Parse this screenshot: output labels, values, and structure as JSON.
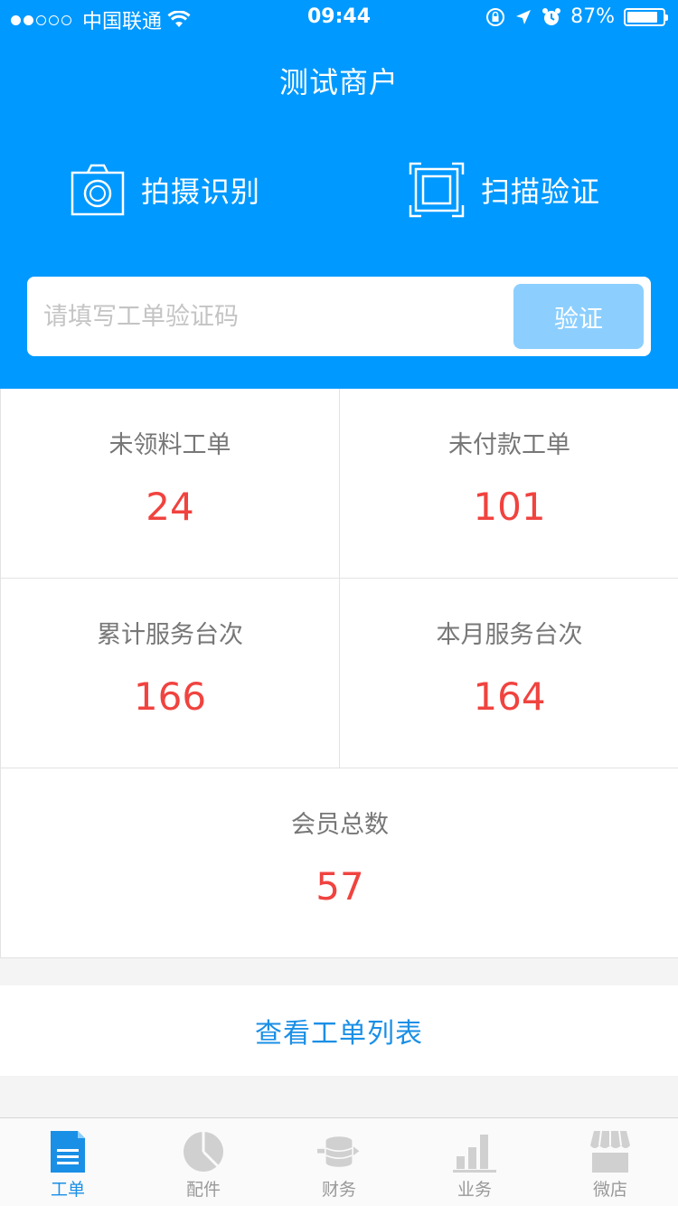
{
  "status_bar": {
    "carrier": "中国联通",
    "time": "09:44",
    "battery": "87%",
    "battery_level": 0.87,
    "signal_bars": 2
  },
  "header": {
    "title": "测试商户",
    "photo_action": {
      "label": "拍摄识别",
      "icon": "camera-icon"
    },
    "scan_action": {
      "label": "扫描验证",
      "icon": "scan-frame-icon"
    }
  },
  "verify": {
    "placeholder": "请填写工单验证码",
    "value": "",
    "button_label": "验证"
  },
  "stats": [
    {
      "label": "未领料工单",
      "value": "24"
    },
    {
      "label": "未付款工单",
      "value": "101"
    },
    {
      "label": "累计服务台次",
      "value": "166"
    },
    {
      "label": "本月服务台次",
      "value": "164"
    },
    {
      "label": "会员总数",
      "value": "57"
    }
  ],
  "list_link": "查看工单列表",
  "tabs": [
    {
      "label": "工单",
      "icon": "document-icon",
      "active": true
    },
    {
      "label": "配件",
      "icon": "pie-chart-icon",
      "active": false
    },
    {
      "label": "财务",
      "icon": "coins-icon",
      "active": false
    },
    {
      "label": "业务",
      "icon": "bar-chart-icon",
      "active": false
    },
    {
      "label": "微店",
      "icon": "store-icon",
      "active": false
    }
  ],
  "colors": {
    "primary": "#0099ff",
    "stat_value": "#f0433f",
    "link": "#1a8fe6",
    "tab_inactive": "#d0d0d0"
  }
}
